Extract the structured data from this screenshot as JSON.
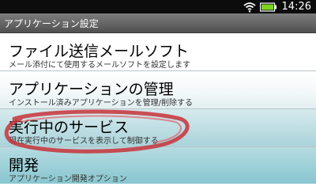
{
  "status_bar": {
    "time": "14:26",
    "icons": [
      "wifi-icon",
      "battery-icon"
    ]
  },
  "title_bar": {
    "title": "アプリケーション設定"
  },
  "list": {
    "items": [
      {
        "title": "ファイル送信メールソフト",
        "subtitle": "メール添付にて使用するメールソフトを設定します"
      },
      {
        "title": "アプリケーションの管理",
        "subtitle": "インストール済みアプリケーションを管理/削除する"
      },
      {
        "title": "実行中のサービス",
        "subtitle": "現在実行中のサービスを表示して制御する"
      },
      {
        "title": "開発",
        "subtitle": "アプリケーション開発オプション"
      }
    ]
  },
  "colors": {
    "status_bar": "#0c0c0c",
    "title_bar": "#6a6a6a",
    "highlight_ring": "#c8323a",
    "battery_level": "#7ed321"
  }
}
